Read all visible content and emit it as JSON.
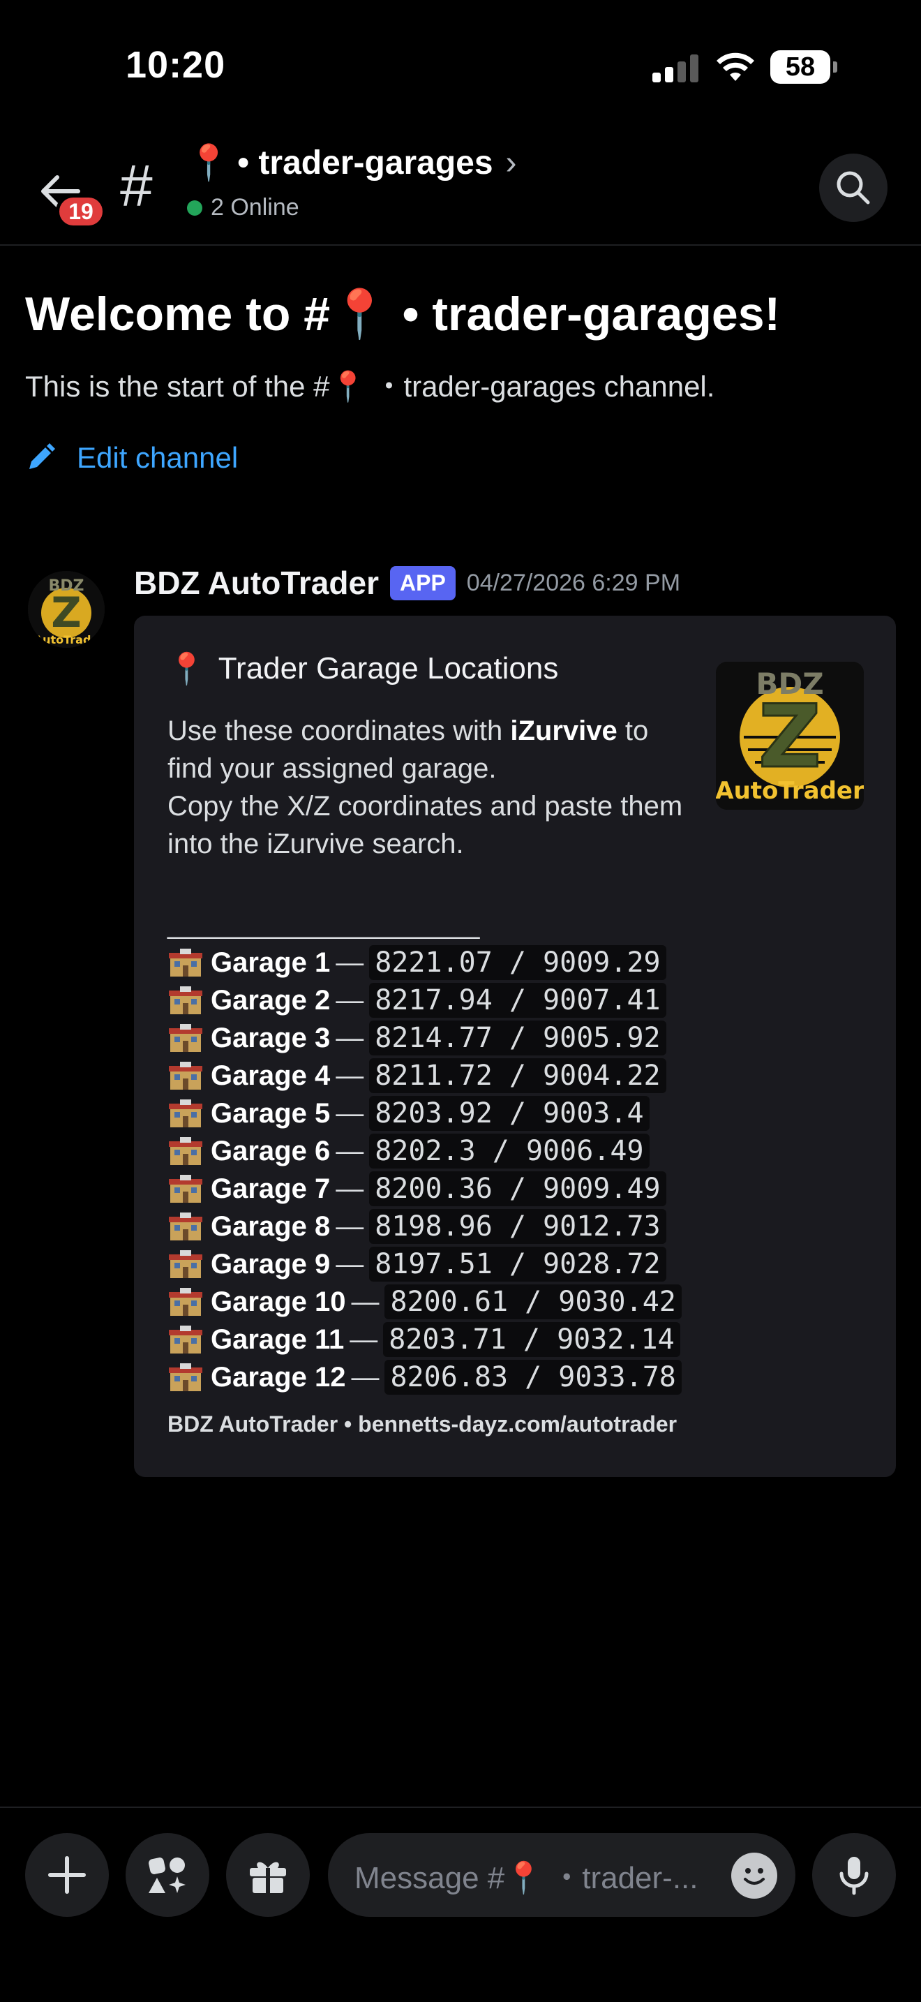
{
  "status_bar": {
    "time": "10:20",
    "battery": "58"
  },
  "header": {
    "back_badge": "19",
    "hash": "#",
    "channel_pin": "📍",
    "channel_name": "• trader-garages",
    "chevron": "›",
    "online_text": "2 Online",
    "online_color": "#23a55a"
  },
  "welcome": {
    "title": "Welcome to #📍 • trader-garages!",
    "subtitle": "This is the start of the #📍 ・trader-garages channel.",
    "edit_label": "Edit channel"
  },
  "message": {
    "author": "BDZ AutoTrader",
    "app_tag": "APP",
    "timestamp": "04/27/2026 6:29 PM",
    "embed": {
      "title_icon": "📍",
      "title": "Trader Garage Locations",
      "desc_1a": "Use these coordinates with ",
      "desc_1b": "iZurvive",
      "desc_1c": " to find your assigned garage.",
      "desc_2": "Copy the X/Z coordinates and paste them into the iZurvive search.",
      "divider": "______________________",
      "garages": [
        {
          "name": "Garage 1",
          "coords": "8221.07 / 9009.29"
        },
        {
          "name": "Garage 2",
          "coords": "8217.94 / 9007.41"
        },
        {
          "name": "Garage 3",
          "coords": "8214.77 / 9005.92"
        },
        {
          "name": "Garage 4",
          "coords": "8211.72 / 9004.22"
        },
        {
          "name": "Garage 5",
          "coords": "8203.92 / 9003.4"
        },
        {
          "name": "Garage 6",
          "coords": "8202.3 / 9006.49"
        },
        {
          "name": "Garage 7",
          "coords": "8200.36 / 9009.49"
        },
        {
          "name": "Garage 8",
          "coords": "8198.96 / 9012.73"
        },
        {
          "name": "Garage 9",
          "coords": "8197.51 / 9028.72"
        },
        {
          "name": "Garage 10",
          "coords": "8200.61 / 9030.42"
        },
        {
          "name": "Garage 11",
          "coords": "8203.71 / 9032.14"
        },
        {
          "name": "Garage 12",
          "coords": "8206.83 / 9033.78"
        }
      ],
      "dash": "—",
      "footer": "BDZ AutoTrader • bennetts-dayz.com/autotrader"
    }
  },
  "composer": {
    "placeholder": "Message #📍 ・trader-..."
  },
  "logo_text": {
    "top": "BDZ",
    "letter": "Z",
    "bottom": "AutoTrader"
  }
}
